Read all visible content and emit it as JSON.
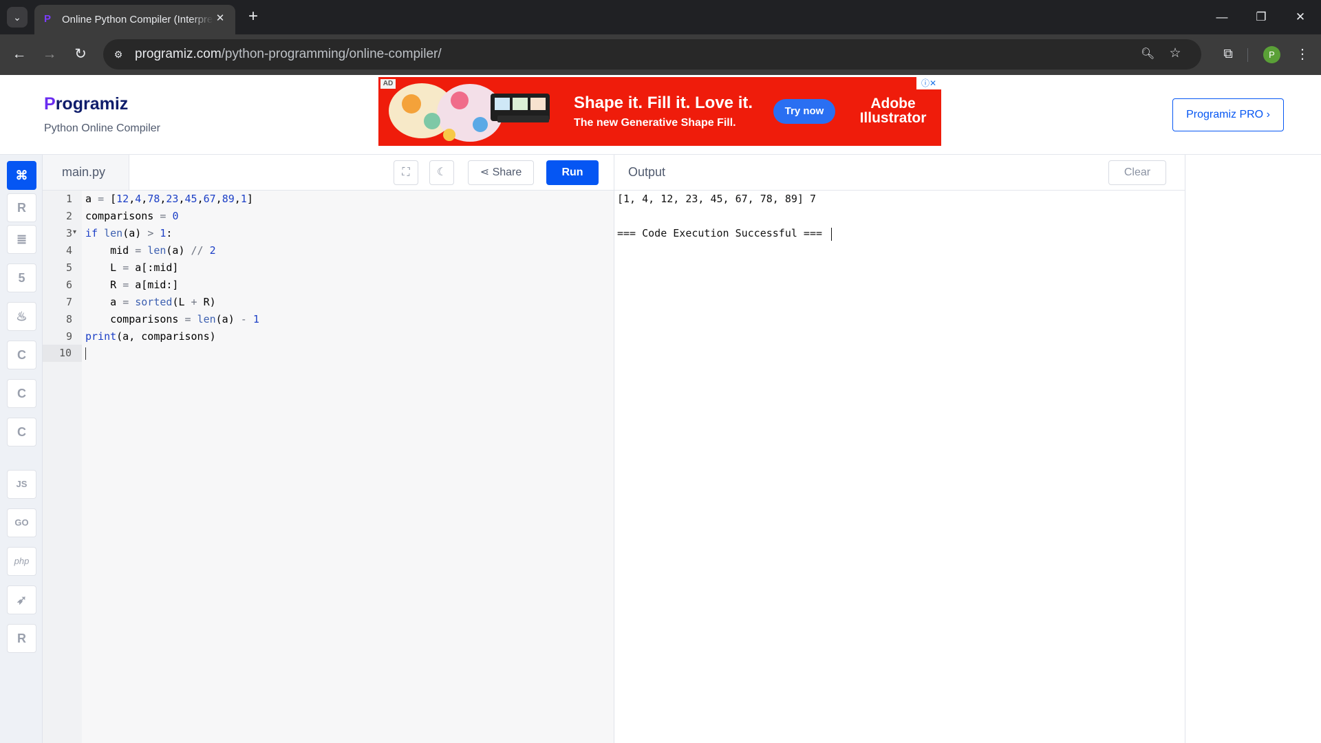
{
  "browser": {
    "tab_title": "Online Python Compiler (Interpreter)",
    "tab_favicon": "P",
    "url_domain": "programiz.com",
    "url_path": "/python-programming/online-compiler/",
    "profile_initial": "P"
  },
  "site": {
    "logo_first": "P",
    "logo_rest": "rogramiz",
    "subtitle": "Python Online Compiler",
    "pro_button": "Programiz PRO ›"
  },
  "ad": {
    "label": "AD",
    "headline": "Shape it. Fill it. Love it.",
    "subline": "The new Generative Shape Fill.",
    "cta": "Try now",
    "brand": "Adobe Illustrator",
    "controls": "ⓘ✕"
  },
  "sidebar": {
    "languages": [
      {
        "name": "python",
        "glyph": "🐍"
      },
      {
        "name": "r",
        "glyph": "R"
      },
      {
        "name": "sql",
        "glyph": "≡"
      },
      {
        "name": "html",
        "glyph": "5"
      },
      {
        "name": "java",
        "glyph": "♨"
      },
      {
        "name": "c",
        "glyph": "C"
      },
      {
        "name": "cpp",
        "glyph": "C"
      },
      {
        "name": "csharp",
        "glyph": "C"
      },
      {
        "name": "js",
        "glyph": "JS"
      },
      {
        "name": "go",
        "glyph": "GO"
      },
      {
        "name": "php",
        "glyph": "php"
      },
      {
        "name": "swift",
        "glyph": "➶"
      },
      {
        "name": "rust",
        "glyph": "R"
      }
    ]
  },
  "editor": {
    "filename": "main.py",
    "share_label": "Share",
    "run_label": "Run",
    "line_numbers": [
      "1",
      "2",
      "3",
      "4",
      "5",
      "6",
      "7",
      "8",
      "9",
      "10"
    ]
  },
  "output": {
    "title": "Output",
    "clear_label": "Clear",
    "lines": [
      "[1, 4, 12, 23, 45, 67, 78, 89] 7",
      "",
      "=== Code Execution Successful ==="
    ]
  },
  "colors": {
    "accent": "#0556f3",
    "ad_background": "#ef1c0b"
  }
}
